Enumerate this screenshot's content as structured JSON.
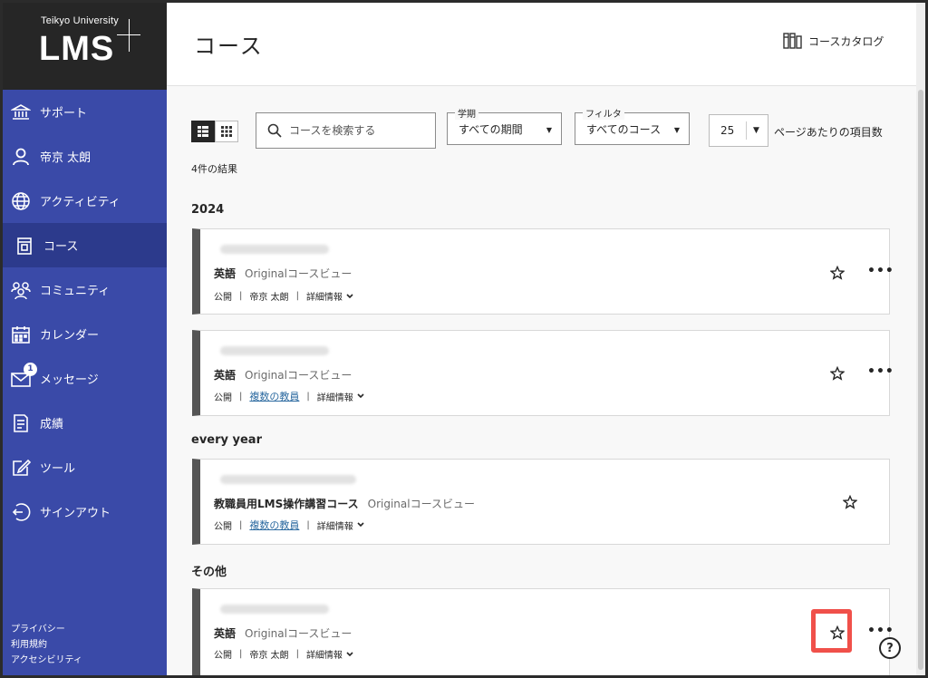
{
  "brand": {
    "university": "Teikyo University",
    "product": "LMS"
  },
  "sidebar": {
    "items": [
      {
        "label": "サポート",
        "icon": "bank-icon"
      },
      {
        "label": "帝京 太朗",
        "icon": "user-icon"
      },
      {
        "label": "アクティビティ",
        "icon": "globe-icon"
      },
      {
        "label": "コース",
        "icon": "course-icon"
      },
      {
        "label": "コミュニティ",
        "icon": "community-icon"
      },
      {
        "label": "カレンダー",
        "icon": "calendar-icon"
      },
      {
        "label": "メッセージ",
        "icon": "mail-icon",
        "badge": "1"
      },
      {
        "label": "成績",
        "icon": "grades-icon"
      },
      {
        "label": "ツール",
        "icon": "tools-icon"
      },
      {
        "label": "サインアウト",
        "icon": "signout-icon"
      }
    ],
    "footer": [
      "プライバシー",
      "利用規約",
      "アクセシビリティ"
    ]
  },
  "header": {
    "title": "コース",
    "catalog_label": "コースカタログ"
  },
  "controls": {
    "search_placeholder": "コースを検索する",
    "term_legend": "学期",
    "term_value": "すべての期間",
    "filter_legend": "フィルタ",
    "filter_value": "すべてのコース",
    "per_page_value": "25",
    "per_page_label": "ページあたりの項目数",
    "results_text": "4件の結果"
  },
  "sections": {
    "s2024": "2024",
    "every_year": "every year",
    "other": "その他"
  },
  "courses": [
    {
      "name": "英語",
      "view": "Originalコースビュー",
      "status": "公開",
      "instructor": "帝京 太朗",
      "instructor_link": false,
      "details": "詳細情報"
    },
    {
      "name": "英語",
      "view": "Originalコースビュー",
      "status": "公開",
      "instructor": "複数の教員",
      "instructor_link": true,
      "details": "詳細情報"
    },
    {
      "name": "教職員用LMS操作講習コース",
      "view": "Originalコースビュー",
      "status": "公開",
      "instructor": "複数の教員",
      "instructor_link": true,
      "details": "詳細情報"
    },
    {
      "name": "英語",
      "view": "Originalコースビュー",
      "status": "公開",
      "instructor": "帝京 太朗",
      "instructor_link": false,
      "details": "詳細情報"
    }
  ],
  "more_label": "•••",
  "help_label": "?",
  "colors": {
    "sidebar": "#3a4aa8",
    "sidebar_active": "#2c3a8c",
    "highlight": "#f0504a",
    "link": "#2c6aa0"
  }
}
